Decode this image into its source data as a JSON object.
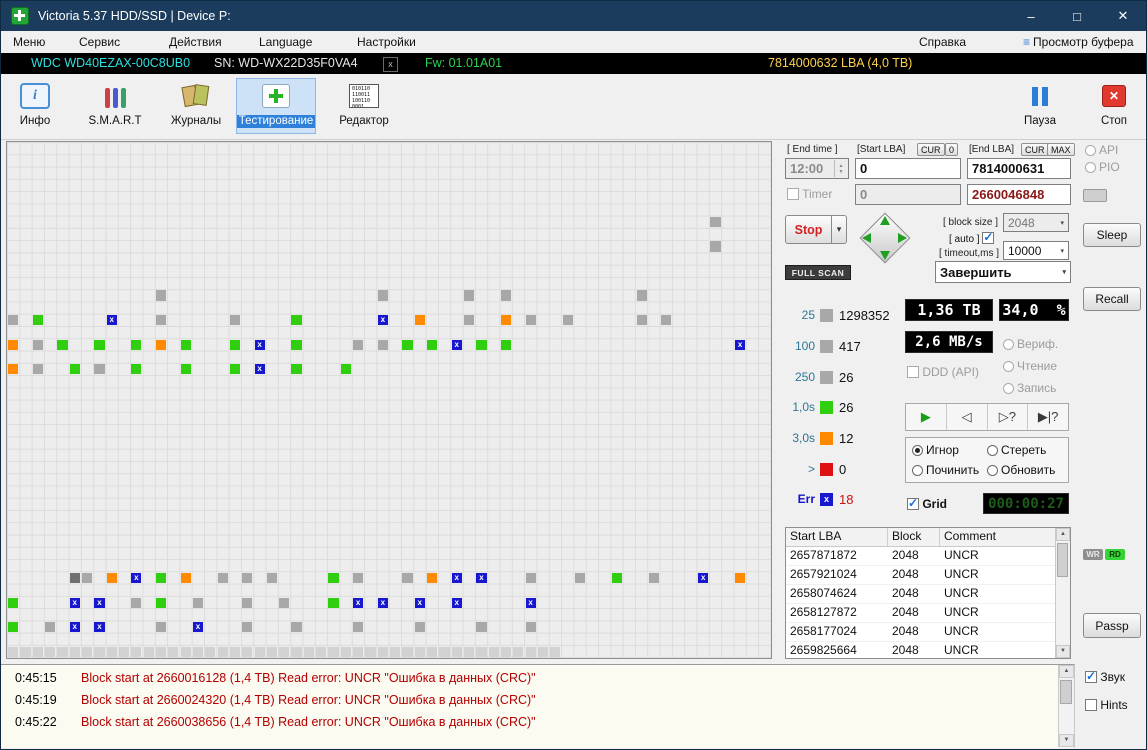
{
  "window": {
    "title": "Victoria 5.37 HDD/SSD | Device P:",
    "minimize": "–",
    "maximize": "□",
    "close": "✕"
  },
  "menu": {
    "items": [
      "Меню",
      "Сервис",
      "Действия",
      "Language",
      "Настройки"
    ],
    "help": "Справка",
    "buffer_view": "Просмотр буфера"
  },
  "device_bar": {
    "model": "WDC WD40EZAX-00C8UB0",
    "serial": "SN: WD-WX22D35F0VA4",
    "close_label": "x",
    "firmware": "Fw: 01.01A01",
    "capacity": "7814000632 LBA (4,0 TB)"
  },
  "toolbar": {
    "info": "Инфо",
    "smart": "S.M.A.R.T",
    "logs": "Журналы",
    "test": "Тестирование",
    "editor": "Редактор",
    "pause": "Пауза",
    "stop": "Стоп",
    "editor_icon_text": "010110\n110011\n100110\n0001"
  },
  "scan_controls": {
    "end_time_label": "[ End time ]",
    "end_time_value": "12:00",
    "start_lba_label": "[Start LBA]",
    "cur_label": "CUR",
    "zero_label": "0",
    "end_lba_label": "[End LBA]",
    "max_label": "MAX",
    "start_lba_value": "0",
    "end_lba_value": "7814000631",
    "timer_label": "Timer",
    "timer_value": "0",
    "current_lba": "2660046848",
    "stop_button": "Stop",
    "full_scan_button": "FULL SCAN",
    "block_size_label": "[ block size ]",
    "block_size_value": "2048",
    "auto_label": "[ auto ]",
    "auto_checked": true,
    "timeout_label": "[ timeout,ms ]",
    "timeout_value": "10000",
    "finish_action": "Завершить"
  },
  "stats": {
    "rows": [
      {
        "label": "25",
        "count": "1298352"
      },
      {
        "label": "100",
        "count": "417"
      },
      {
        "label": "250",
        "count": "26"
      },
      {
        "label": "1,0s",
        "count": "26"
      },
      {
        "label": "3,0s",
        "count": "12"
      },
      {
        "label": ">",
        "count": "0"
      },
      {
        "label": "Err",
        "count": "18"
      }
    ]
  },
  "progress": {
    "scanned": "1,36 TB",
    "percent": "34,0  %",
    "speed": "2,6 MB/s",
    "timer": "000:00:27",
    "grid_label": "Grid",
    "grid_checked": true
  },
  "mode": {
    "verify": "Вериф.",
    "read": "Чтение",
    "write": "Запись",
    "ddd": "DDD (API)"
  },
  "playbar": {
    "play": "▶",
    "back": "◁",
    "step": "▷?",
    "skip": "▶|?"
  },
  "actions": {
    "ignore": "Игнор",
    "erase": "Стереть",
    "repair": "Починить",
    "refresh": "Обновить",
    "ignore_selected": true
  },
  "defect_table": {
    "headers": [
      "Start LBA",
      "Block",
      "Comment"
    ],
    "rows": [
      [
        "2657871872",
        "2048",
        "UNCR"
      ],
      [
        "2657921024",
        "2048",
        "UNCR"
      ],
      [
        "2658074624",
        "2048",
        "UNCR"
      ],
      [
        "2658127872",
        "2048",
        "UNCR"
      ],
      [
        "2658177024",
        "2048",
        "UNCR"
      ],
      [
        "2659825664",
        "2048",
        "UNCR"
      ]
    ]
  },
  "side_panel": {
    "api": "API",
    "pio": "PIO",
    "sleep": "Sleep",
    "recall": "Recall",
    "wr": "WR",
    "rd": "RD",
    "passp": "Passp"
  },
  "log": {
    "entries": [
      {
        "time": "0:45:15",
        "message": "Block start at 2660016128 (1,4 TB) Read error: UNCR \"Ошибка в данных (CRC)\""
      },
      {
        "time": "0:45:19",
        "message": "Block start at 2660024320 (1,4 TB) Read error: UNCR \"Ошибка в данных (CRC)\""
      },
      {
        "time": "0:45:22",
        "message": "Block start at 2660038656 (1,4 TB) Read error: UNCR \"Ошибка в данных (CRC)\""
      }
    ]
  },
  "misc": {
    "sound": "Звук",
    "sound_checked": true,
    "hints": "Hints",
    "hints_checked": false
  },
  "scan_grid": {
    "cols": 62,
    "rows": 42,
    "trail": {
      "row": 41,
      "from": 0,
      "to": 44
    },
    "cells": [
      [
        6,
        57,
        "g"
      ],
      [
        8,
        57,
        "g"
      ],
      [
        12,
        12,
        "g"
      ],
      [
        12,
        30,
        "g"
      ],
      [
        12,
        37,
        "g"
      ],
      [
        12,
        40,
        "g"
      ],
      [
        12,
        51,
        "g"
      ],
      [
        14,
        0,
        "g"
      ],
      [
        14,
        2,
        "G"
      ],
      [
        14,
        8,
        "x"
      ],
      [
        14,
        12,
        "g"
      ],
      [
        14,
        18,
        "g"
      ],
      [
        14,
        23,
        "G"
      ],
      [
        14,
        30,
        "x"
      ],
      [
        14,
        33,
        "o"
      ],
      [
        14,
        37,
        "g"
      ],
      [
        14,
        40,
        "o"
      ],
      [
        14,
        42,
        "g"
      ],
      [
        14,
        45,
        "g"
      ],
      [
        14,
        51,
        "g"
      ],
      [
        14,
        53,
        "g"
      ],
      [
        16,
        0,
        "o"
      ],
      [
        16,
        2,
        "g"
      ],
      [
        16,
        4,
        "G"
      ],
      [
        16,
        7,
        "G"
      ],
      [
        16,
        10,
        "G"
      ],
      [
        16,
        12,
        "o"
      ],
      [
        16,
        14,
        "G"
      ],
      [
        16,
        18,
        "G"
      ],
      [
        16,
        20,
        "x"
      ],
      [
        16,
        23,
        "G"
      ],
      [
        16,
        28,
        "g"
      ],
      [
        16,
        30,
        "g"
      ],
      [
        16,
        32,
        "G"
      ],
      [
        16,
        34,
        "G"
      ],
      [
        16,
        36,
        "x"
      ],
      [
        16,
        38,
        "G"
      ],
      [
        16,
        40,
        "G"
      ],
      [
        16,
        59,
        "x"
      ],
      [
        18,
        0,
        "o"
      ],
      [
        18,
        2,
        "g"
      ],
      [
        18,
        5,
        "G"
      ],
      [
        18,
        7,
        "g"
      ],
      [
        18,
        10,
        "G"
      ],
      [
        18,
        14,
        "G"
      ],
      [
        18,
        18,
        "G"
      ],
      [
        18,
        20,
        "x"
      ],
      [
        18,
        23,
        "G"
      ],
      [
        18,
        27,
        "G"
      ],
      [
        35,
        5,
        "d"
      ],
      [
        35,
        6,
        "g"
      ],
      [
        35,
        8,
        "o"
      ],
      [
        35,
        10,
        "x"
      ],
      [
        35,
        12,
        "G"
      ],
      [
        35,
        14,
        "o"
      ],
      [
        35,
        17,
        "g"
      ],
      [
        35,
        19,
        "g"
      ],
      [
        35,
        21,
        "g"
      ],
      [
        35,
        26,
        "G"
      ],
      [
        35,
        28,
        "g"
      ],
      [
        35,
        32,
        "g"
      ],
      [
        35,
        34,
        "o"
      ],
      [
        35,
        36,
        "x"
      ],
      [
        35,
        38,
        "x"
      ],
      [
        35,
        42,
        "g"
      ],
      [
        35,
        46,
        "g"
      ],
      [
        35,
        49,
        "G"
      ],
      [
        35,
        52,
        "g"
      ],
      [
        35,
        56,
        "x"
      ],
      [
        35,
        59,
        "o"
      ],
      [
        37,
        0,
        "G"
      ],
      [
        37,
        5,
        "x"
      ],
      [
        37,
        7,
        "x"
      ],
      [
        37,
        10,
        "g"
      ],
      [
        37,
        12,
        "G"
      ],
      [
        37,
        15,
        "g"
      ],
      [
        37,
        19,
        "g"
      ],
      [
        37,
        22,
        "g"
      ],
      [
        37,
        26,
        "G"
      ],
      [
        37,
        28,
        "x"
      ],
      [
        37,
        30,
        "x"
      ],
      [
        37,
        33,
        "x"
      ],
      [
        37,
        36,
        "x"
      ],
      [
        37,
        42,
        "x"
      ],
      [
        39,
        0,
        "G"
      ],
      [
        39,
        3,
        "g"
      ],
      [
        39,
        5,
        "x"
      ],
      [
        39,
        7,
        "x"
      ],
      [
        39,
        12,
        "g"
      ],
      [
        39,
        15,
        "x"
      ],
      [
        39,
        19,
        "g"
      ],
      [
        39,
        23,
        "g"
      ],
      [
        39,
        28,
        "g"
      ],
      [
        39,
        33,
        "g"
      ],
      [
        39,
        38,
        "g"
      ],
      [
        39,
        42,
        "g"
      ]
    ]
  }
}
